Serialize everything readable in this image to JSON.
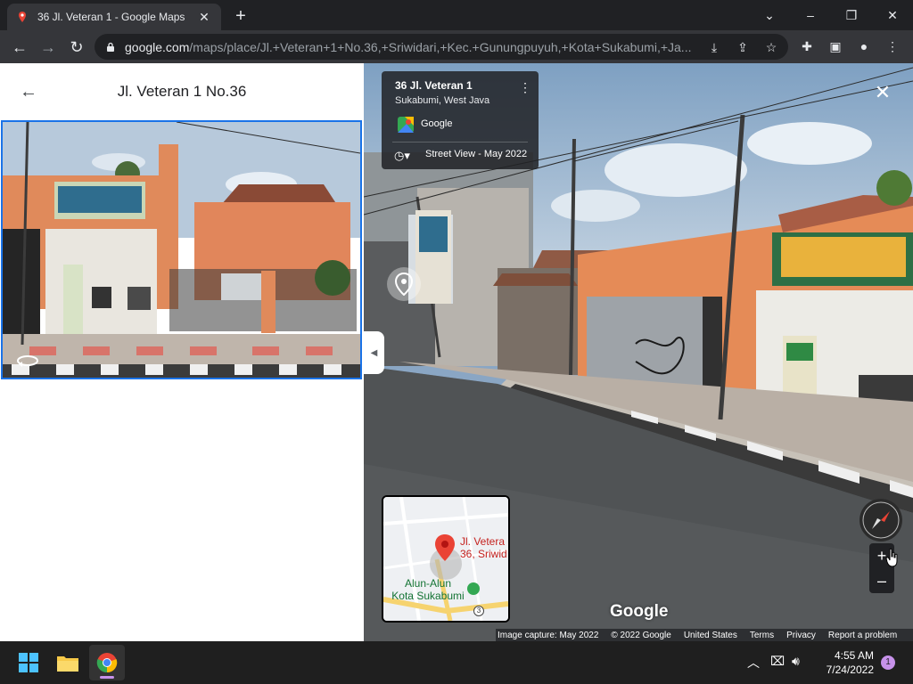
{
  "browser": {
    "tab_title": "36 Jl. Veteran 1 - Google Maps",
    "url_host": "google.com",
    "url_path": "/maps/place/Jl.+Veteran+1+No.36,+Sriwidari,+Kec.+Gunungpuyuh,+Kota+Sukabumi,+Ja...",
    "icons": [
      "maps-favicon",
      "close-tab-icon",
      "new-tab-icon",
      "back-icon",
      "forward-icon",
      "reload-icon",
      "lock-icon",
      "install-icon",
      "share-icon",
      "star-icon",
      "extensions-icon",
      "sidebar-icon",
      "profile-icon",
      "menu-icon"
    ]
  },
  "panel": {
    "title": "Jl. Veteran 1 No.36"
  },
  "streetview": {
    "address": "36 Jl. Veteran 1",
    "locality": "Sukabumi, West Java",
    "provider": "Google",
    "capture_label": "Street View - May 2022",
    "watermark": "Google",
    "minimap": {
      "place_label_1": "Jl. Vetera",
      "place_label_2": "36, Sriwid",
      "poi_label_1": "Alun-Alun",
      "poi_label_2": "Kota Sukabumi",
      "road_shield": "3"
    },
    "footer": {
      "capture": "Image capture: May 2022",
      "copyright": "© 2022 Google",
      "region": "United States",
      "terms": "Terms",
      "privacy": "Privacy",
      "report": "Report a problem"
    },
    "colors": {
      "highlight_border": "#1a73e8",
      "pin_red": "#ea4335"
    }
  },
  "taskbar": {
    "time": "4:55 AM",
    "date": "7/24/2022",
    "notification_count": "1"
  }
}
